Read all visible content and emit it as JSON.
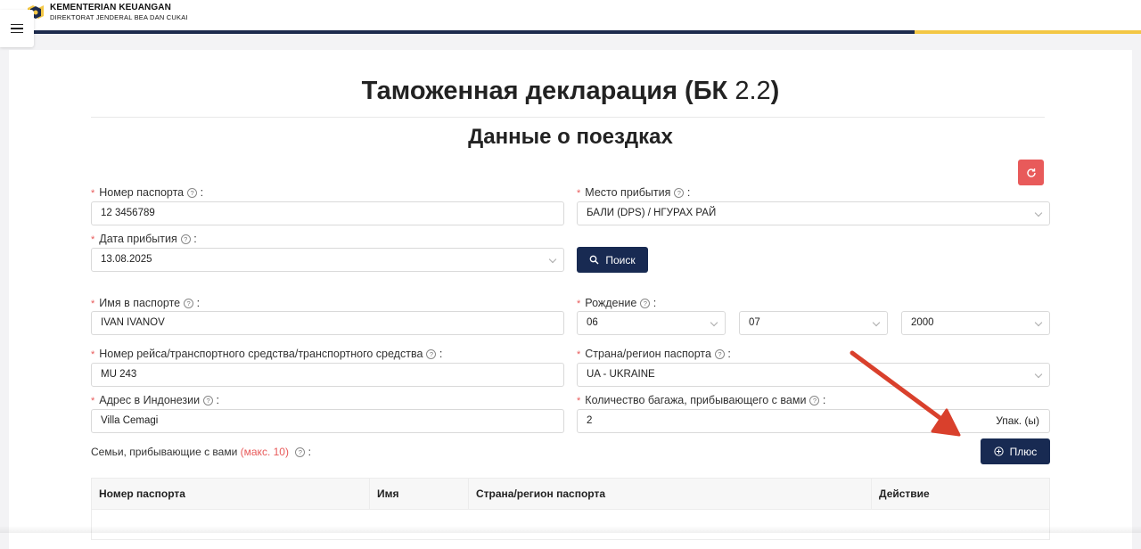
{
  "header": {
    "brand_line1": "KEMENTERIAN KEUANGAN",
    "brand_line2": "DIREKTORAT JENDERAL BEA DAN CUKAI"
  },
  "page": {
    "title_main": "Таможенная декларация (БК ",
    "title_num": "2.2",
    "title_close": ")",
    "subtitle": "Данные о поездках"
  },
  "form": {
    "passport_number": {
      "label": "Номер паспорта",
      "value": "12 3456789"
    },
    "arrival_place": {
      "label": "Место прибытия",
      "value": "БАЛИ (DPS) / НГУРАХ РАЙ"
    },
    "arrival_date": {
      "label": "Дата прибытия",
      "value": "13.08.2025"
    },
    "search_label": "Поиск",
    "passport_name": {
      "label": "Имя в паспорте",
      "value": "IVAN IVANOV"
    },
    "birth": {
      "label": "Рождение",
      "day": "06",
      "month": "07",
      "year": "2000"
    },
    "flight_number": {
      "label": "Номер рейса/транспортного средства/транспортного средства",
      "value": "MU 243"
    },
    "passport_country": {
      "label": "Страна/регион паспорта",
      "value": "UA - UKRAINE"
    },
    "address": {
      "label": "Адрес в Индонезии",
      "value": "Villa Cemagi"
    },
    "baggage": {
      "label": "Количество багажа, прибывающего с вами",
      "value": "2",
      "unit": "Упак. (ы)"
    },
    "family_label": "Семьи, прибывающие с вами",
    "family_max": "(макс. 10)",
    "plus_label": "Плюс"
  },
  "table": {
    "columns": [
      "Номер паспорта",
      "Имя",
      "Страна/регион паспорта",
      "Действие"
    ]
  },
  "colors": {
    "navy": "#182a52",
    "gold": "#f3c745",
    "danger": "#e85a5a",
    "arrow": "#d9402c"
  }
}
